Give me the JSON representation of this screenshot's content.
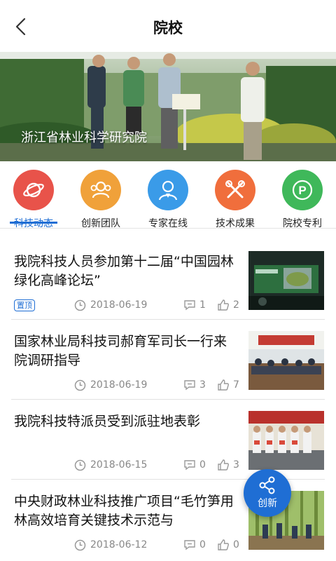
{
  "header": {
    "title": "院校",
    "back_icon": "chevron-left-icon"
  },
  "banner": {
    "caption": "浙江省林业科学研究院"
  },
  "categories": [
    {
      "label": "科技动态",
      "icon": "planet-icon",
      "color": "#e8534a",
      "active": true
    },
    {
      "label": "创新团队",
      "icon": "team-icon",
      "color": "#f0a13a",
      "active": false
    },
    {
      "label": "专家在线",
      "icon": "expert-icon",
      "color": "#3a9be8",
      "active": false
    },
    {
      "label": "技术成果",
      "icon": "tools-icon",
      "color": "#f06e3c",
      "active": false
    },
    {
      "label": "院校专利",
      "icon": "patent-icon",
      "color": "#3fb85a",
      "active": false
    }
  ],
  "colors": {
    "accent": "#1f6ed4",
    "text": "#111111",
    "meta": "#888888"
  },
  "news": [
    {
      "title": "我院科技人员参加第十二届“中国园林绿化高峰论坛”",
      "pinned": "置顶",
      "date": "2018-06-19",
      "comments": "1",
      "likes": "2"
    },
    {
      "title": "国家林业局科技司郝育军司长一行来院调研指导",
      "date": "2018-06-19",
      "comments": "3",
      "likes": "7"
    },
    {
      "title": "我院科技特派员受到派驻地表彰",
      "date": "2018-06-15",
      "comments": "0",
      "likes": "3"
    },
    {
      "title": "中央财政林业科技推广项目“毛竹笋用林高效培育关键技术示范与",
      "date": "2018-06-12",
      "comments": "0",
      "likes": "0"
    }
  ],
  "fab": {
    "label": "创新",
    "icon": "share-icon"
  }
}
